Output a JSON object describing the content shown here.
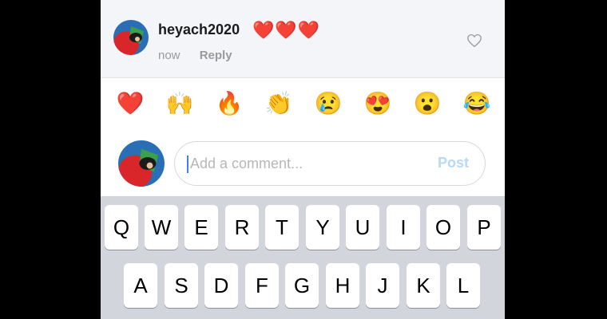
{
  "comment": {
    "username": "heyach2020",
    "hearts": "❤️❤️❤️",
    "timestamp": "now",
    "reply_label": "Reply",
    "like_icon": "heart-outline-icon"
  },
  "emoji_bar": [
    "❤️",
    "🙌",
    "🔥",
    "👏",
    "😢",
    "😍",
    "😮",
    "😂"
  ],
  "composer": {
    "placeholder": "Add a comment...",
    "value": "",
    "post_label": "Post",
    "post_color": "#b9d8f5"
  },
  "keyboard": {
    "row1": [
      "Q",
      "W",
      "E",
      "R",
      "T",
      "Y",
      "U",
      "I",
      "O",
      "P"
    ],
    "row2": [
      "A",
      "S",
      "D",
      "F",
      "G",
      "H",
      "J",
      "K",
      "L"
    ]
  },
  "colors": {
    "frame": "#000000",
    "comment_bg": "#f4f5f9",
    "keyboard_bg": "#d2d5db",
    "caret": "#3b82f6"
  }
}
